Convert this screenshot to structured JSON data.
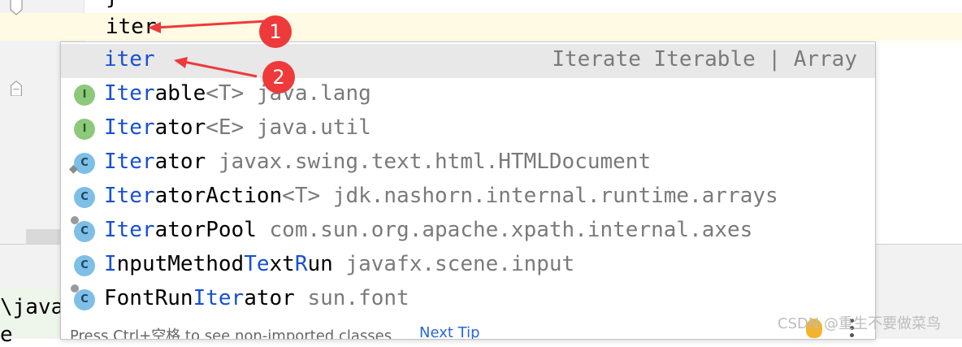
{
  "editor": {
    "brace_line": "}",
    "typed_text": "iter"
  },
  "popup": {
    "items": [
      {
        "prefix": "iter",
        "rest": "",
        "type_param": "",
        "tail": "",
        "right": "Iterate Iterable | Array",
        "icon": "none"
      },
      {
        "prefix": "Iter",
        "rest": "able",
        "type_param": "<T>",
        "tail": " java.lang",
        "icon": "interface-icon",
        "icon_letter": "I"
      },
      {
        "prefix": "Iter",
        "rest": "ator",
        "type_param": "<E>",
        "tail": " java.util",
        "icon": "interface-icon",
        "icon_letter": "I"
      },
      {
        "prefix": "Iter",
        "rest": "ator",
        "type_param": "",
        "tail": " javax.swing.text.html.HTMLDocument",
        "icon": "class-icon",
        "icon_letter": "C"
      },
      {
        "prefix": "Iter",
        "rest": "atorAction",
        "type_param": "<T>",
        "tail": " jdk.nashorn.internal.runtime.arrays",
        "icon": "class-icon",
        "icon_letter": "C"
      },
      {
        "prefix": "Iter",
        "rest": "atorPool",
        "type_param": "",
        "tail": " com.sun.org.apache.xpath.internal.axes",
        "icon": "class-icon",
        "icon_letter": "C"
      },
      {
        "prefix": "I",
        "rest": "nputMethod",
        "highlight2": "Te",
        "rest2": "xt",
        "highlight3": "R",
        "rest3": "un",
        "tail": " javafx.scene.input",
        "icon": "class-icon",
        "icon_letter": "C"
      },
      {
        "pre": "FontRun",
        "prefix": "Iter",
        "rest": "ator",
        "tail": " sun.font",
        "icon": "class-icon",
        "icon_letter": "C"
      }
    ],
    "footer_text": "Press Ctrl+空格 to see non-imported classes",
    "footer_link": "Next Tip"
  },
  "annotations": {
    "badge1": "1",
    "badge2": "2"
  },
  "bottom_left": {
    "line1": "\\java",
    "line2": "e"
  },
  "watermark": "CSDN @重生不要做菜鸟",
  "colors": {
    "match": "#1750d2",
    "badge": "#ee3a3a",
    "selection": "#e8e8e8"
  }
}
